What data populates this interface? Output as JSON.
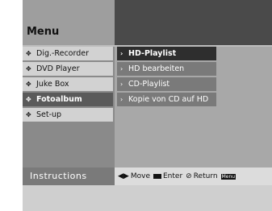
{
  "header": {
    "title": "Menu"
  },
  "left_menu": {
    "items": [
      {
        "label": "Dig.-Recorder",
        "bullet": "✥"
      },
      {
        "label": "DVD Player",
        "bullet": "✥"
      },
      {
        "label": "Juke Box",
        "bullet": "✥"
      },
      {
        "label": "Fotoalbum",
        "bullet": "✥",
        "active": true
      },
      {
        "label": "Set-up",
        "bullet": "✥"
      }
    ]
  },
  "submenu": {
    "items": [
      {
        "label": "HD-Playlist",
        "chevron": "›",
        "active": true
      },
      {
        "label": "HD bearbeiten",
        "chevron": "›"
      },
      {
        "label": "CD-Playlist",
        "chevron": "›"
      },
      {
        "label": "Kopie von CD auf HD",
        "chevron": "›"
      }
    ]
  },
  "instructions": {
    "label": "Instructions",
    "move_icon": "◀▶",
    "move": "Move",
    "enter": "Enter",
    "return_icon": "⊘",
    "return": "Return",
    "menu_key": "Menu"
  },
  "colors": {
    "selected": "#5a5a5a",
    "submenu_selected": "#2e2e2e"
  }
}
